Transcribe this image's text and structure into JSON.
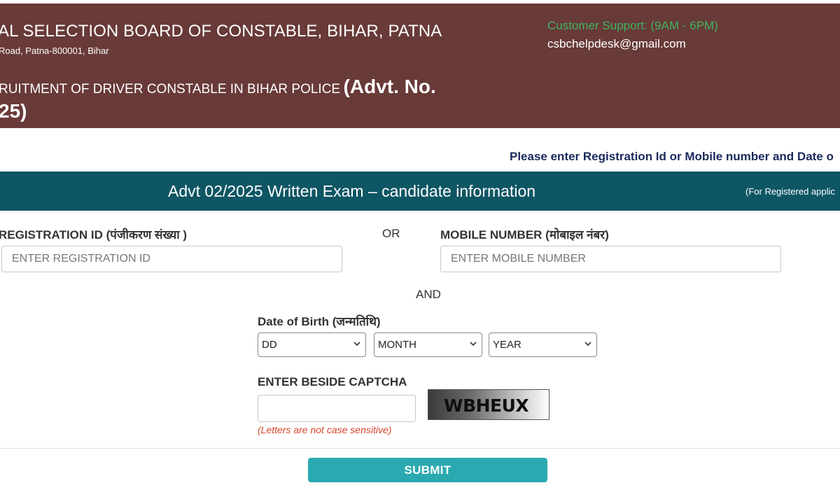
{
  "header": {
    "org_name": "AL SELECTION BOARD OF CONSTABLE, BIHAR, PATNA",
    "address": "Road, Patna-800001, Bihar",
    "recruitment_line1": "RUITMENT OF DRIVER CONSTABLE IN BIHAR POLICE",
    "recruitment_advt": "(Advt. No.",
    "recruitment_line2": "25)",
    "support_label": "Customer Support: (9AM - 6PM)",
    "support_email": "csbchelpdesk@gmail.com"
  },
  "instruction": "Please enter Registration Id or Mobile number and Date o",
  "form_bar": {
    "title": "Advt 02/2025 Written Exam – candidate information",
    "note": "(For Registered applic"
  },
  "form": {
    "registration_label": "REGISTRATION ID (पंजीकरण संख्या )",
    "registration_placeholder": "ENTER REGISTRATION ID",
    "or_text": "OR",
    "mobile_label": "MOBILE NUMBER (मोबाइल नंबर)",
    "mobile_placeholder": "ENTER MOBILE NUMBER",
    "and_text": "AND",
    "dob_label": "Date of Birth (जन्मतिथि)",
    "dob_day": "DD",
    "dob_month": "MONTH",
    "dob_year": "YEAR",
    "captcha_label": "ENTER BESIDE CAPTCHA",
    "captcha_value": "",
    "captcha_hint": "(Letters are not case sensitive)",
    "captcha_text": "WBHEUX",
    "submit_label": "SUBMIT"
  },
  "colors": {
    "header_bg": "#683a38",
    "support_label": "#3fb35f",
    "bar_bg": "#0e5664",
    "instruction_text": "#1a2a5c",
    "hint_text": "#d8442a",
    "submit_bg": "#2ba9b0"
  },
  "icons": [
    "chevron-down-icon"
  ]
}
